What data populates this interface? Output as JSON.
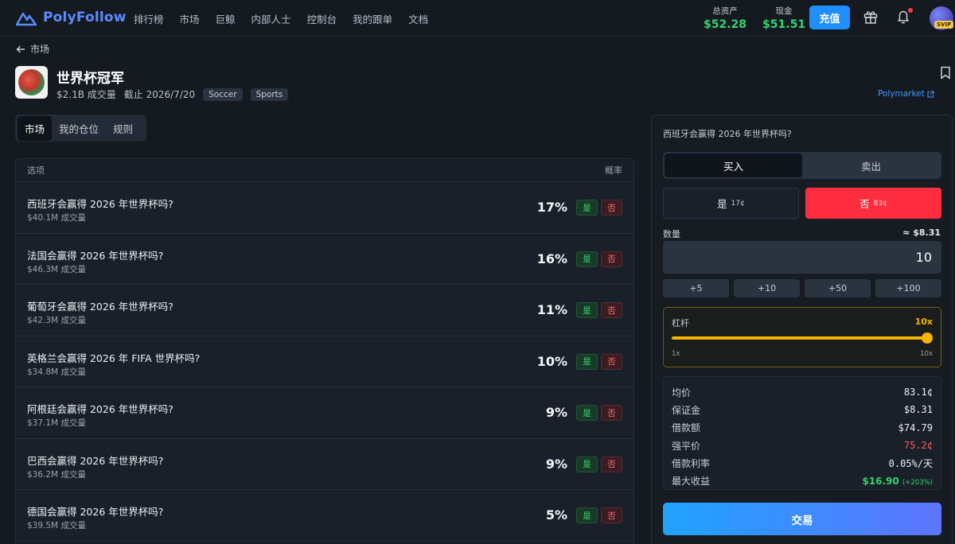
{
  "brand": {
    "name": "PolyFollow"
  },
  "nav": [
    "排行榜",
    "市场",
    "巨鲸",
    "内部人士",
    "控制台",
    "我的跟单",
    "文档"
  ],
  "balances": {
    "total_label": "总资产",
    "total_value": "$52.28",
    "cash_label": "现金",
    "cash_value": "$51.51"
  },
  "topup_label": "充值",
  "svip": "SVIP",
  "back_label": "市场",
  "event": {
    "title": "世界杯冠军",
    "volume": "$2.1B 成交量",
    "deadline": "截止 2026/7/20",
    "tags": [
      "Soccer",
      "Sports"
    ],
    "source_link": "Polymarket"
  },
  "tabs": [
    "市场",
    "我的仓位",
    "规则"
  ],
  "table": {
    "col_option": "选项",
    "col_prob": "概率",
    "rows": [
      {
        "title": "西班牙会赢得 2026 年世界杯吗?",
        "volume": "$40.1M 成交量",
        "prob": "17%",
        "yes": "是",
        "no": "否"
      },
      {
        "title": "法国会赢得 2026 年世界杯吗?",
        "volume": "$46.3M 成交量",
        "prob": "16%",
        "yes": "是",
        "no": "否"
      },
      {
        "title": "葡萄牙会赢得 2026 年世界杯吗?",
        "volume": "$42.3M 成交量",
        "prob": "11%",
        "yes": "是",
        "no": "否"
      },
      {
        "title": "英格兰会赢得 2026 年 FIFA 世界杯吗?",
        "volume": "$34.8M 成交量",
        "prob": "10%",
        "yes": "是",
        "no": "否"
      },
      {
        "title": "阿根廷会赢得 2026 年世界杯吗?",
        "volume": "$37.1M 成交量",
        "prob": "9%",
        "yes": "是",
        "no": "否"
      },
      {
        "title": "巴西会赢得 2026 年世界杯吗?",
        "volume": "$36.2M 成交量",
        "prob": "9%",
        "yes": "是",
        "no": "否"
      },
      {
        "title": "德国会赢得 2026 年世界杯吗?",
        "volume": "$39.5M 成交量",
        "prob": "5%",
        "yes": "是",
        "no": "否"
      }
    ]
  },
  "panel": {
    "question": "西班牙会赢得 2026 年世界杯吗?",
    "buy_label": "买入",
    "sell_label": "卖出",
    "yes_label": "是",
    "yes_price": "17¢",
    "no_label": "否",
    "no_price": "83¢",
    "qty_label": "数量",
    "qty_estimate": "≈ $8.31",
    "qty_value": "10",
    "quick": [
      "+5",
      "+10",
      "+50",
      "+100"
    ],
    "leverage_label": "杠杆",
    "leverage_value": "10x",
    "leverage_level": 1.0,
    "leverage_min": "1x",
    "leverage_max": "10x",
    "summary": {
      "avg_label": "均价",
      "avg_value": "83.1¢",
      "margin_label": "保证金",
      "margin_value": "$8.31",
      "borrow_label": "借款额",
      "borrow_value": "$74.79",
      "liq_label": "强平价",
      "liq_value": "75.2¢",
      "rate_label": "借款利率",
      "rate_value": "0.05%/天",
      "max_label": "最大收益",
      "max_value": "$16.90",
      "max_pct": "(+203%)"
    },
    "trade_label": "交易"
  },
  "colors": {
    "accent": "#1f8fff",
    "yes": "#3bd172",
    "no": "#ff2d3f",
    "leverage": "#f5b400"
  }
}
